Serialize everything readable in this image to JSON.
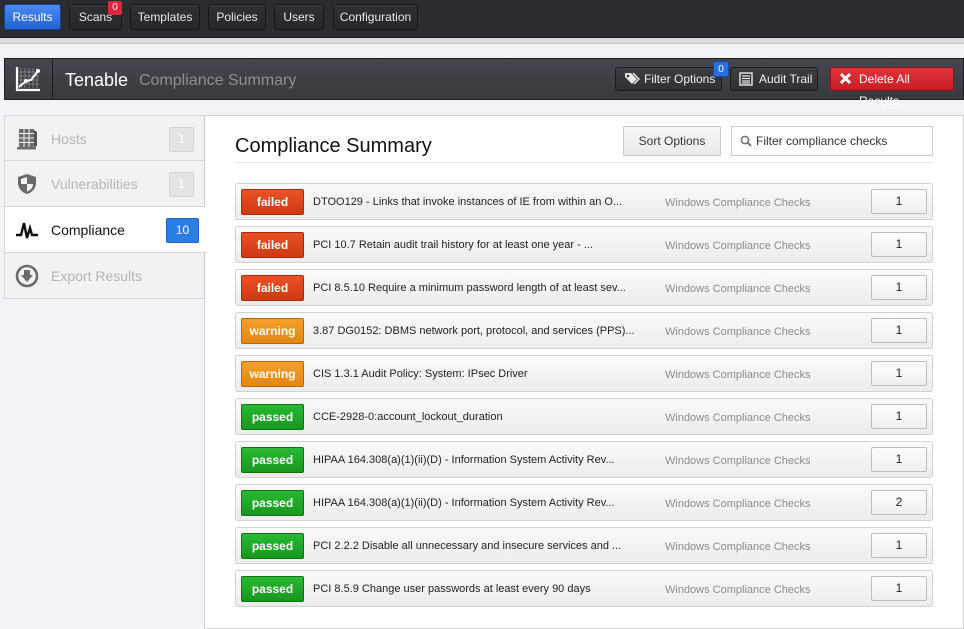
{
  "topnav": {
    "items": [
      {
        "label": "Results",
        "active": true
      },
      {
        "label": "Scans",
        "badge": "0"
      },
      {
        "label": "Templates"
      },
      {
        "label": "Policies"
      },
      {
        "label": "Users"
      },
      {
        "label": "Configuration"
      }
    ]
  },
  "header": {
    "logo_icon": "chart-line-icon",
    "title": "Tenable",
    "subtitle": "Compliance Summary",
    "filter_options_label": "Filter Options",
    "filter_options_badge": "0",
    "audit_trail_label": "Audit Trail",
    "delete_all_label": "Delete All Results"
  },
  "sidebar": {
    "items": [
      {
        "label": "Hosts",
        "count": "1",
        "icon": "server-stack-icon"
      },
      {
        "label": "Vulnerabilities",
        "count": "1",
        "icon": "shield-icon"
      },
      {
        "label": "Compliance",
        "count": "10",
        "icon": "pulse-icon",
        "active": true
      },
      {
        "label": "Export Results",
        "icon": "download-circle-icon"
      }
    ]
  },
  "main": {
    "title": "Compliance Summary",
    "sort_label": "Sort Options",
    "filter_placeholder": "Filter compliance checks",
    "colors": {
      "failed": "#d9411a",
      "warning": "#ee9320",
      "passed": "#1fa828",
      "accent": "#2d7de8"
    },
    "rows": [
      {
        "status": "failed",
        "name": "DTOO129 - Links that invoke instances of IE from within an O...",
        "family": "Windows Compliance Checks",
        "count": "1"
      },
      {
        "status": "failed",
        "name": "PCI 10.7 Retain audit trail history for at least one year - ...",
        "family": "Windows Compliance Checks",
        "count": "1"
      },
      {
        "status": "failed",
        "name": "PCI 8.5.10 Require a minimum password length of at least sev...",
        "family": "Windows Compliance Checks",
        "count": "1"
      },
      {
        "status": "warning",
        "name": "3.87 DG0152: DBMS network port, protocol, and services (PPS)...",
        "family": "Windows Compliance Checks",
        "count": "1"
      },
      {
        "status": "warning",
        "name": "CIS 1.3.1 Audit Policy: System: IPsec Driver",
        "family": "Windows Compliance Checks",
        "count": "1"
      },
      {
        "status": "passed",
        "name": "CCE-2928-0:account_lockout_duration",
        "family": "Windows Compliance Checks",
        "count": "1"
      },
      {
        "status": "passed",
        "name": "HIPAA 164.308(a)(1)(ii)(D) - Information System Activity Rev...",
        "family": "Windows Compliance Checks",
        "count": "1"
      },
      {
        "status": "passed",
        "name": "HIPAA 164.308(a)(1)(ii)(D) - Information System Activity Rev...",
        "family": "Windows Compliance Checks",
        "count": "2"
      },
      {
        "status": "passed",
        "name": "PCI 2.2.2 Disable all unnecessary and insecure services and ...",
        "family": "Windows Compliance Checks",
        "count": "1"
      },
      {
        "status": "passed",
        "name": "PCI 8.5.9 Change user passwords at least every 90 days",
        "family": "Windows Compliance Checks",
        "count": "1"
      }
    ]
  }
}
